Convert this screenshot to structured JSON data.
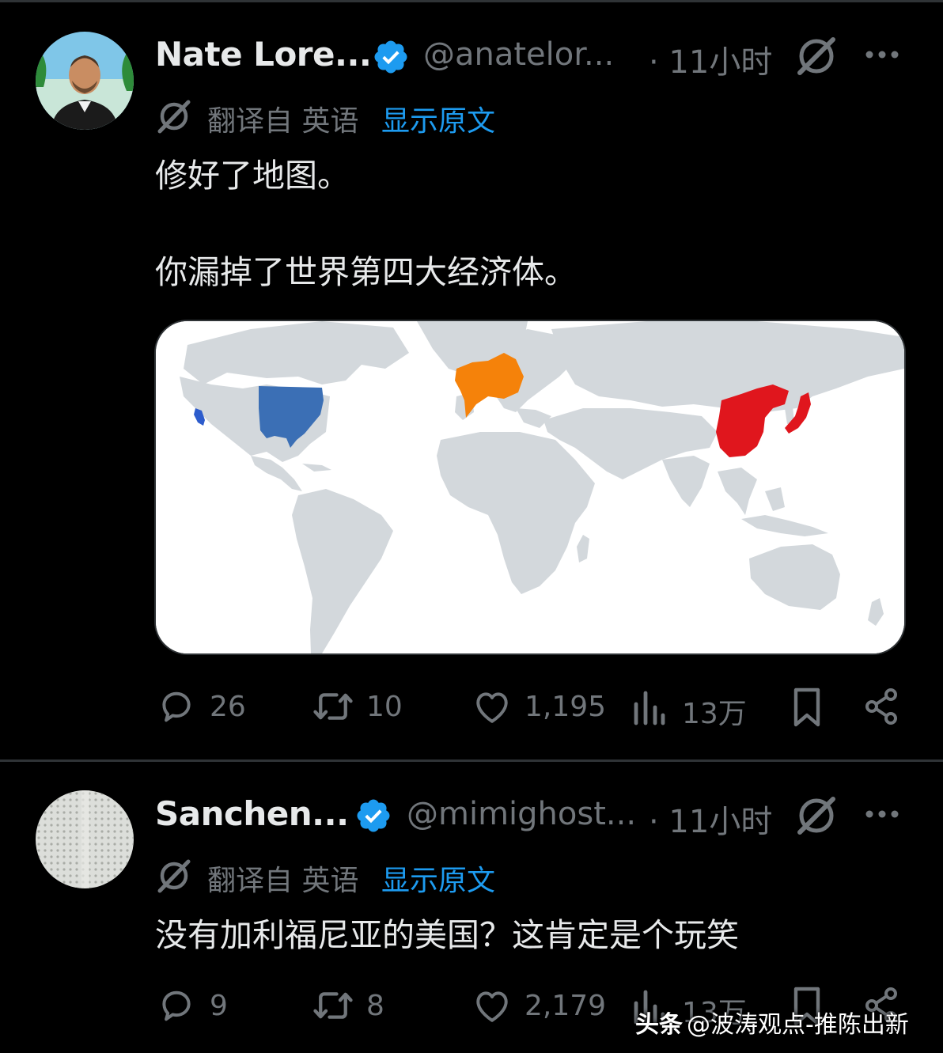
{
  "tweets": [
    {
      "name": "Nate Lore...",
      "handle": "@anatelor...",
      "time": "· 11小时",
      "translated_from": "翻译自 英语",
      "show_original": "显示原文",
      "text_lines": [
        "修好了地图。",
        "你漏掉了世界第四大经济体。"
      ],
      "stats": {
        "replies": "26",
        "reposts": "10",
        "likes": "1,195",
        "views": "13万"
      }
    },
    {
      "name": "Sanchen...",
      "handle": "@mimighost...",
      "time": "· 11小时",
      "translated_from": "翻译自 英语",
      "show_original": "显示原文",
      "text_lines": [
        "没有加利福尼亚的美国？这肯定是个玩笑"
      ],
      "stats": {
        "replies": "9",
        "reposts": "8",
        "likes": "2,179",
        "views": "13万"
      }
    }
  ],
  "watermark": {
    "brand": "头条",
    "text": "@波涛观点-推陈出新"
  },
  "colors": {
    "background": "#000000",
    "text": "#e7e9ea",
    "secondary": "#71767b",
    "link": "#1d9bf0",
    "verified": "#1d9bf0",
    "map_usa": "#3b6fb5",
    "map_california": "#2d5ccc",
    "map_europe": "#f5820a",
    "map_china": "#e0161d"
  },
  "icons": [
    "verified-badge-icon",
    "grok-icon",
    "more-icon",
    "translate-icon",
    "reply-icon",
    "repost-icon",
    "like-icon",
    "views-icon",
    "bookmark-icon",
    "share-icon"
  ]
}
